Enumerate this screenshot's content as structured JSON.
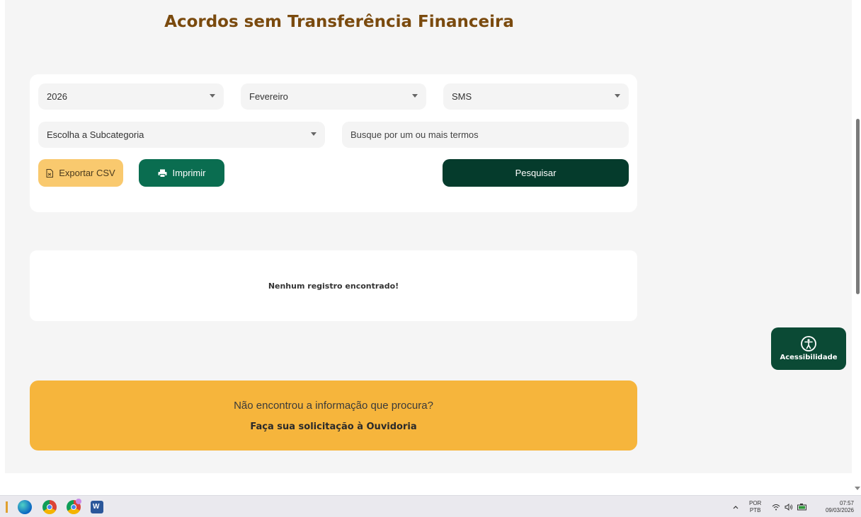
{
  "page": {
    "title": "Acordos sem Transferência Financeira"
  },
  "filters": {
    "year": "2026",
    "month": "Fevereiro",
    "category": "SMS",
    "subcategory_placeholder": "Escolha a Subcategoria",
    "search_placeholder": "Busque por um ou mais termos"
  },
  "actions": {
    "export_csv": "Exportar CSV",
    "print": "Imprimir",
    "search": "Pesquisar"
  },
  "results": {
    "empty_message": "Nenhum registro encontrado!"
  },
  "ouvidoria": {
    "question": "Não encontrou a informação que procura?",
    "link": "Faça sua solicitação à Ouvidoria"
  },
  "accessibility": {
    "label": "Acessibilidade"
  },
  "taskbar": {
    "apps": [
      "edge-icon",
      "chrome-icon",
      "chrome-profile-icon",
      "word-icon"
    ],
    "language": "POR",
    "keyboard": "PTB",
    "time": "07:57",
    "date": "09/03/2026"
  },
  "colors": {
    "title": "#7a4a0e",
    "primary_dark": "#053b2c",
    "primary": "#0a6d50",
    "csv_button": "#f9c96e",
    "ouvidoria": "#f6b53c"
  }
}
